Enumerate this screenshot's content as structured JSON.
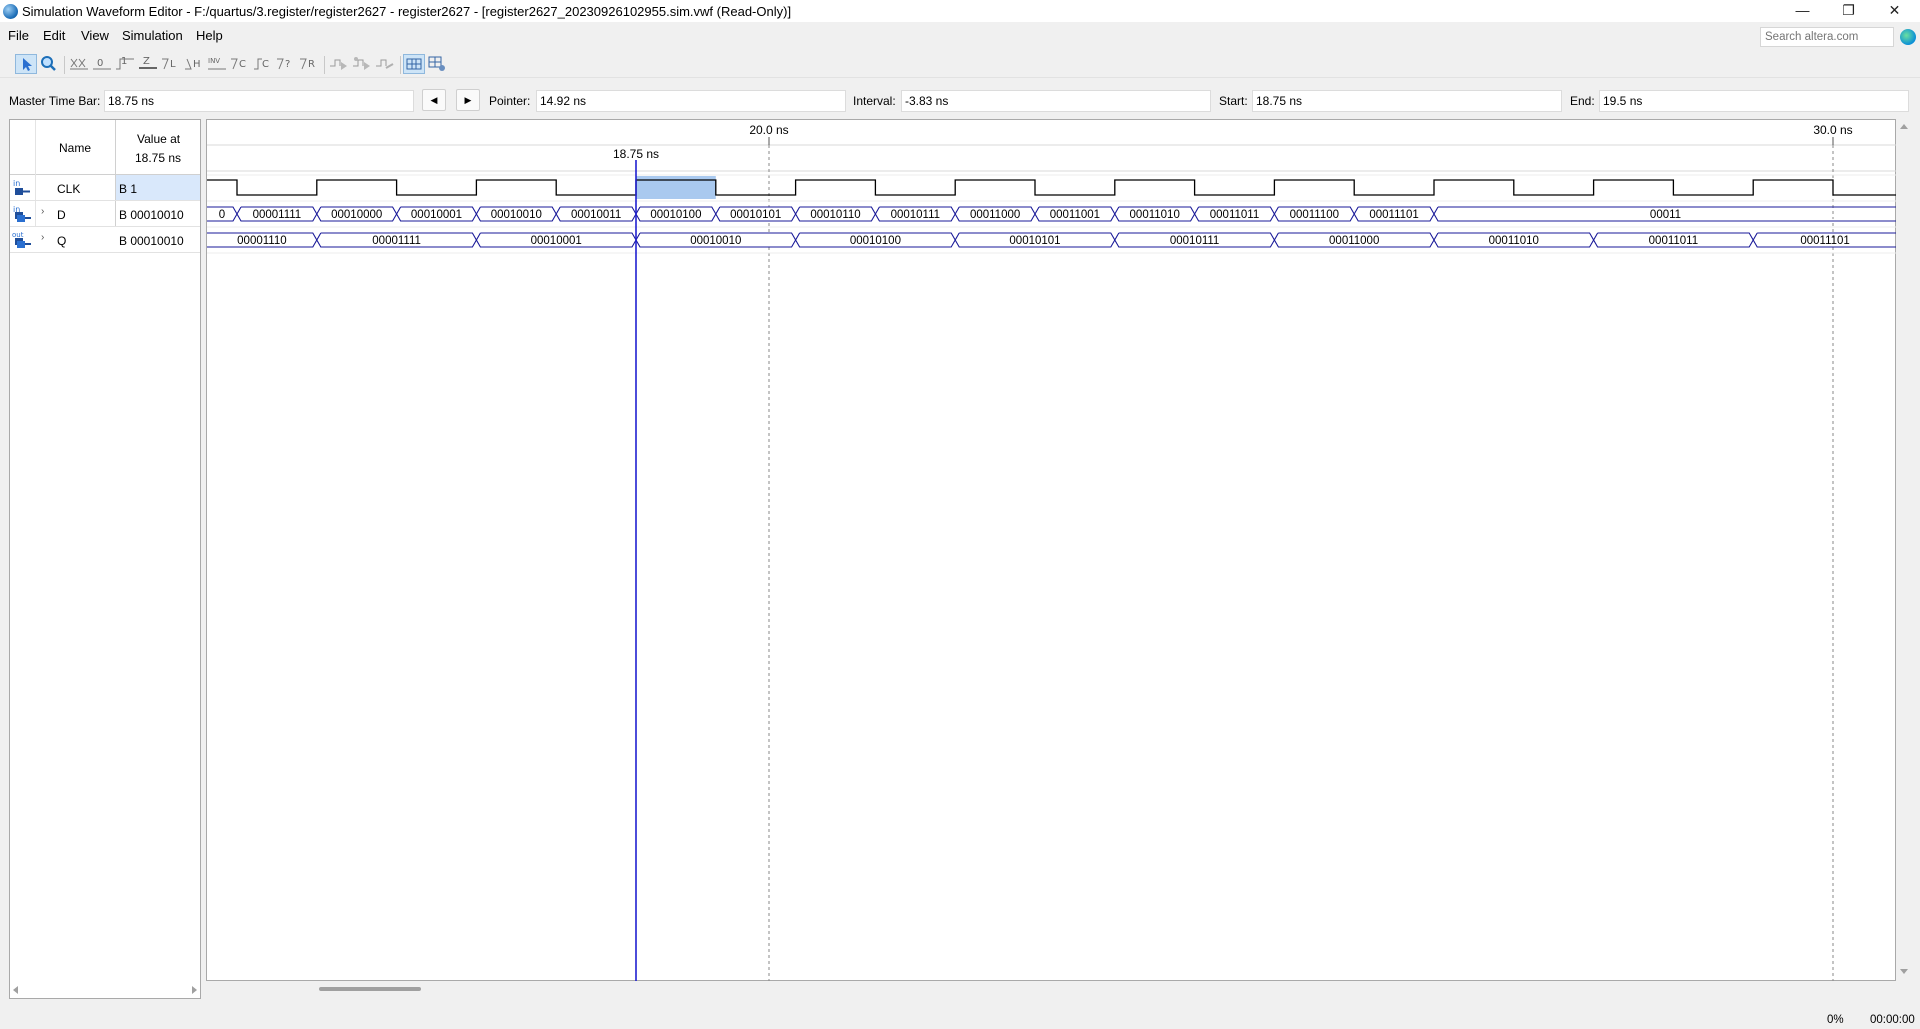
{
  "window": {
    "title": "Simulation Waveform Editor - F:/quartus/3.register/register2627 - register2627 - [register2627_20230926102955.sim.vwf (Read-Only)]",
    "controls": {
      "minimize": "—",
      "restore": "❐",
      "close": "✕"
    }
  },
  "menu": {
    "items": [
      "File",
      "Edit",
      "View",
      "Simulation",
      "Help"
    ],
    "search_placeholder": "Search altera.com"
  },
  "toolbar": {
    "tools": [
      "selection-tool-icon",
      "zoom-tool-icon",
      "force-unknown-icon",
      "force-low-icon",
      "force-high-icon",
      "force-high-impedance-icon",
      "force-weak-low-icon",
      "force-weak-high-icon",
      "invert-icon",
      "count-value-icon",
      "force-clock-icon",
      "force-dont-care-icon",
      "random-values-icon",
      "run-functional-simulation-icon",
      "run-timing-simulation-icon",
      "generate-netlist-icon",
      "snap-to-grid-icon",
      "grid-settings-icon"
    ]
  },
  "time_bar": {
    "master_label": "Master Time Bar:",
    "master_value": "18.75 ns",
    "pointer_label": "Pointer:",
    "pointer_value": "14.92 ns",
    "interval_label": "Interval:",
    "interval_value": "-3.83 ns",
    "start_label": "Start:",
    "start_value": "18.75 ns",
    "end_label": "End:",
    "end_value": "19.5 ns"
  },
  "signal_table": {
    "header_name": "Name",
    "header_value_line1": "Value at",
    "header_value_line2": "18.75 ns",
    "signals": [
      {
        "name": "CLK",
        "value": "B 1",
        "direction": "in",
        "expandable": false,
        "selected": true
      },
      {
        "name": "D",
        "value": "B 00010010",
        "direction": "in",
        "expandable": true,
        "selected": false
      },
      {
        "name": "Q",
        "value": "B 00010010",
        "direction": "out",
        "expandable": true,
        "selected": false
      }
    ]
  },
  "waveform": {
    "time_labels": [
      "20.0 ns",
      "30.0 ns"
    ],
    "cursor_label": "18.75 ns",
    "clk_period_ns": 1.5,
    "clk_rise_times_ns": [
      15.75,
      17.25,
      18.75,
      20.25,
      21.75,
      23.25,
      24.75,
      26.25,
      27.75,
      29.25
    ],
    "d_values": [
      "0",
      "00001111",
      "00010000",
      "00010001",
      "00010010",
      "00010011",
      "00010100",
      "00010101",
      "00010110",
      "00010111",
      "00011000",
      "00011001",
      "00011010",
      "00011011",
      "00011100",
      "00011101",
      "00011"
    ],
    "q_values": [
      "00001110",
      "00001111",
      "00010001",
      "00010010",
      "00010100",
      "00010101",
      "00010111",
      "00011000",
      "00011010",
      "00011011",
      "00011101"
    ],
    "colors": {
      "bus": "#1a1a99",
      "cursor": "#2020d0",
      "highlight": "#a9c9ef",
      "grid": "#8a8a8a"
    }
  },
  "status": {
    "progress": "0%",
    "elapsed": "00:00:00"
  }
}
